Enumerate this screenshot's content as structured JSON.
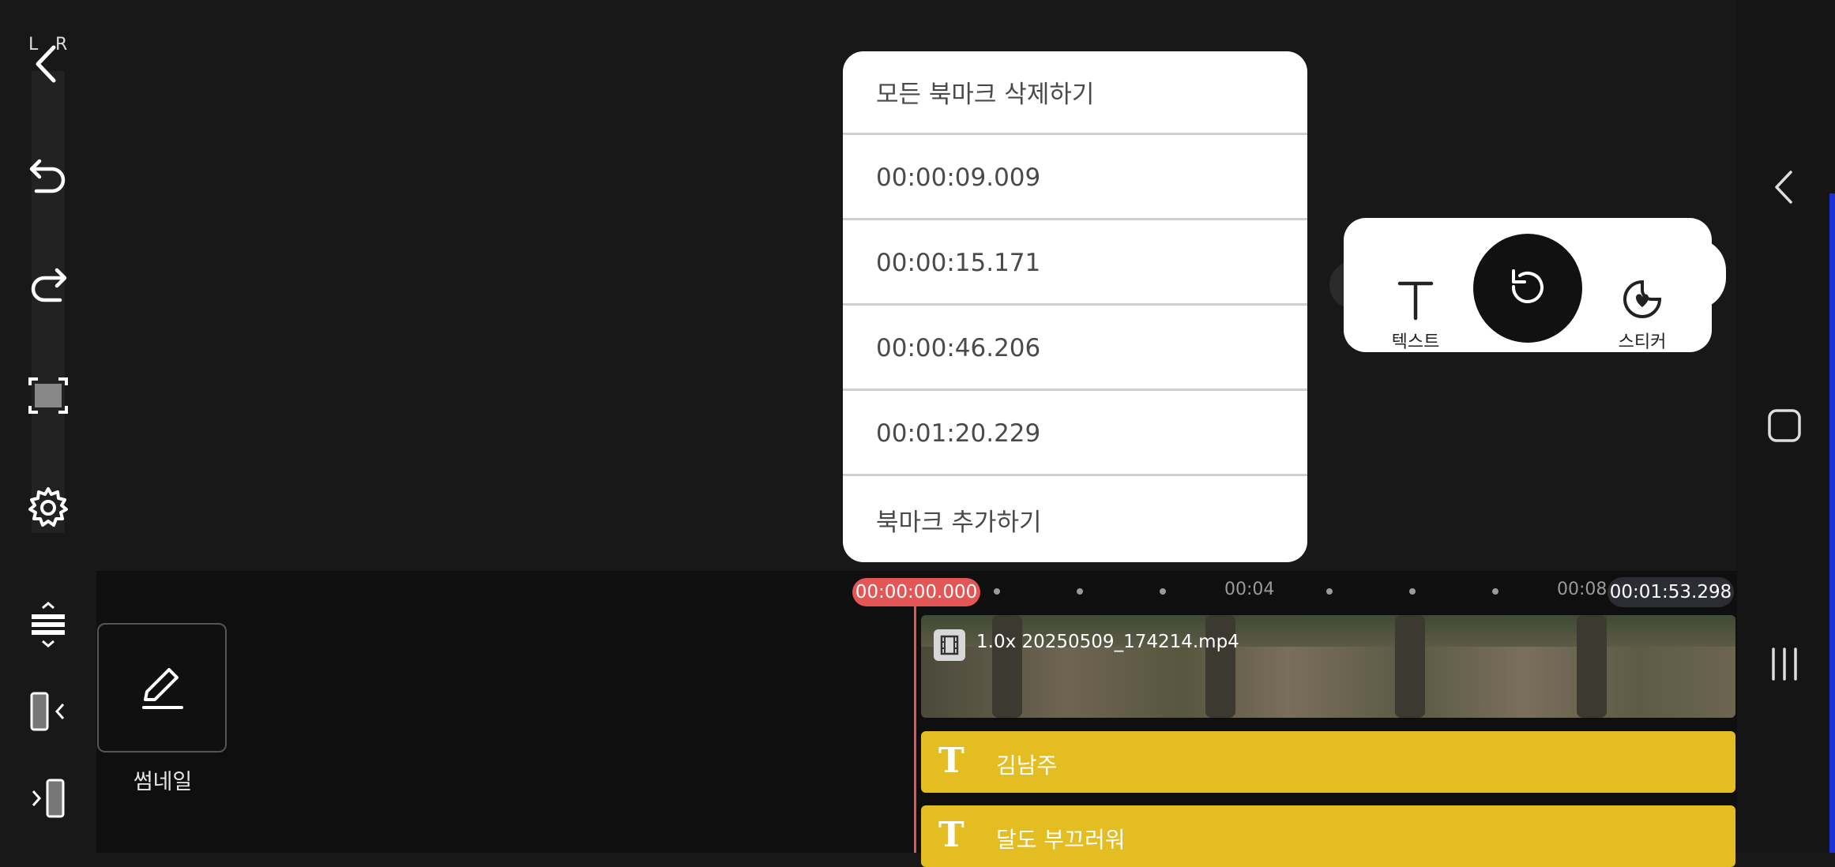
{
  "toolbar": {
    "lr_left": "L",
    "lr_right": "R"
  },
  "bookmark_menu": {
    "delete_all": "모든 북마크 삭제하기",
    "bookmarks": [
      "00:00:09.009",
      "00:00:15.171",
      "00:00:46.206",
      "00:01:20.229"
    ],
    "add_bookmark": "북마크 추가하기"
  },
  "float_tools": {
    "text_label": "텍스트",
    "sticker_label": "스티커"
  },
  "timeline": {
    "playhead_time": "00:00:00.000",
    "tick_1": "00:04",
    "tick_2": "00:08",
    "total_time": "00:01:53.298",
    "video_clip_name": "1.0x 20250509_174214.mp4",
    "text_clip_1": "김남주",
    "text_clip_2": "달도 부끄러워",
    "text_clip_icon": "T"
  },
  "thumbnail": {
    "label": "썸네일"
  },
  "icons": {
    "back": "back-arrow-icon",
    "undo": "undo-icon",
    "redo": "redo-icon",
    "fullscreen": "fullscreen-icon",
    "settings": "gear-icon",
    "edit": "pencil-icon"
  },
  "colors": {
    "accent_red": "#e45555",
    "text_clip_yellow": "#e3bd22",
    "nav_accent": "#1a2fd6"
  }
}
